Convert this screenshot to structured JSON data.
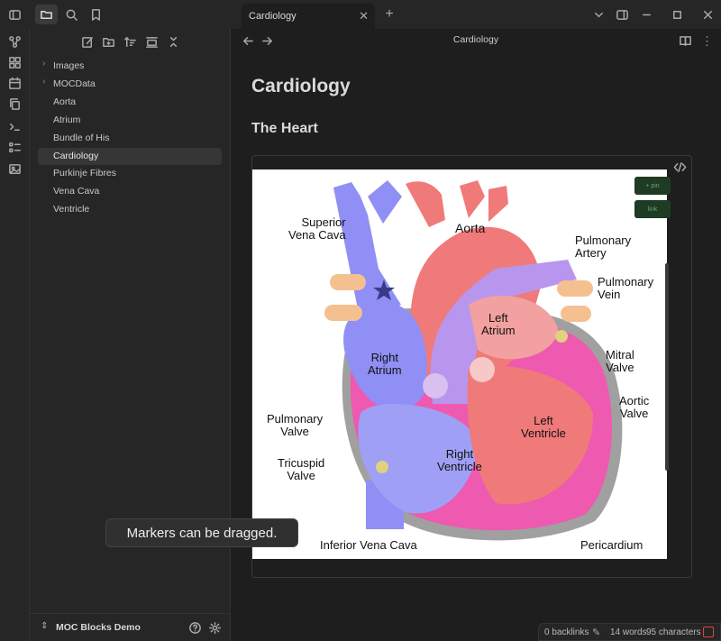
{
  "titlebar": {
    "tab_title": "Cardiology"
  },
  "sidebar": {
    "items": [
      {
        "label": "Images",
        "folder": true
      },
      {
        "label": "MOCData",
        "folder": true
      },
      {
        "label": "Aorta"
      },
      {
        "label": "Atrium"
      },
      {
        "label": "Bundle of His"
      },
      {
        "label": "Cardiology",
        "active": true
      },
      {
        "label": "Purkinje Fibres"
      },
      {
        "label": "Vena Cava"
      },
      {
        "label": "Ventricle"
      }
    ],
    "vault_name": "MOC Blocks Demo"
  },
  "main": {
    "header_title": "Cardiology",
    "h1": "Cardiology",
    "h2": "The Heart"
  },
  "diagram": {
    "labels": {
      "superior_vena_cava": "Superior\nVena Cava",
      "aorta": "Aorta",
      "pulmonary_artery": "Pulmonary\nArtery",
      "pulmonary_vein": "Pulmonary\nVein",
      "left_atrium": "Left\nAtrium",
      "right_atrium": "Right\nAtrium",
      "mitral_valve": "Mitral\nValve",
      "aortic_valve": "Aortic\nValve",
      "pulmonary_valve": "Pulmonary\nValve",
      "left_ventricle": "Left\nVentricle",
      "right_ventricle": "Right\nVentricle",
      "tricuspid_valve": "Tricuspid\nValve",
      "inferior_vena_cava": "Inferior Vena Cava",
      "pericardium": "Pericardium"
    },
    "btn_pin": "+ pin",
    "btn_link": "link",
    "colors": {
      "blue": "#8f8ff5",
      "red": "#f07a7a",
      "purple": "#b896ee",
      "pink": "#f060b0",
      "peach": "#f5c090"
    }
  },
  "toast": "Markers can be dragged.",
  "status": {
    "backlinks": "0 backlinks",
    "words": "14 words",
    "characters": "95 characters"
  }
}
